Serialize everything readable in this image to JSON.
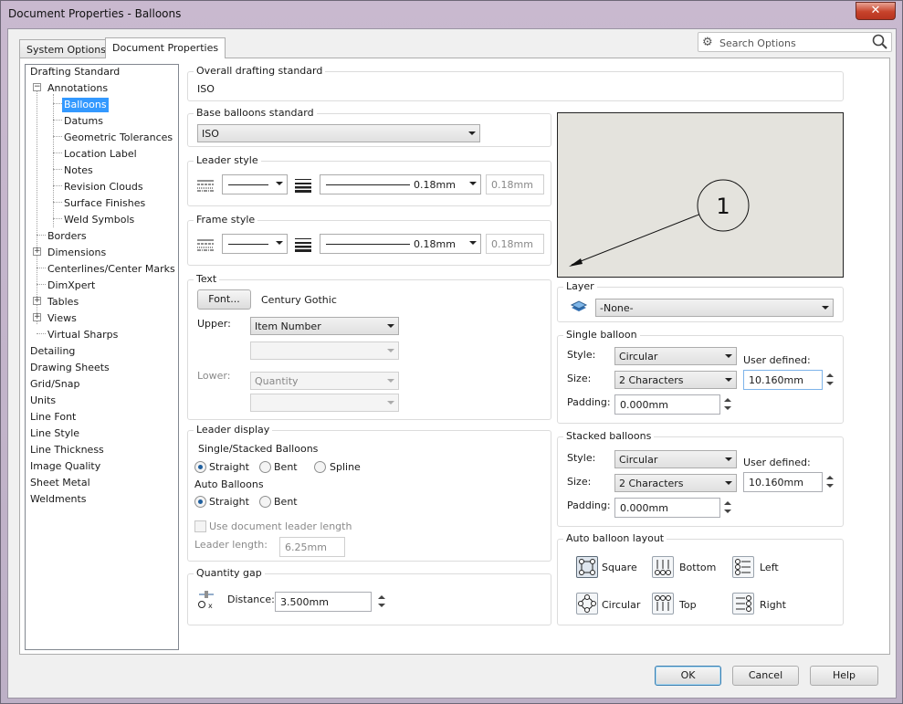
{
  "window": {
    "title": "Document Properties - Balloons",
    "close": "✕"
  },
  "tabs": [
    {
      "label": "System Options"
    },
    {
      "label": "Document Properties"
    }
  ],
  "search": {
    "placeholder": "Search Options"
  },
  "tree": {
    "items": [
      "Drafting Standard",
      "Annotations",
      "Balloons",
      "Datums",
      "Geometric Tolerances",
      "Location Label",
      "Notes",
      "Revision Clouds",
      "Surface Finishes",
      "Weld Symbols",
      "Borders",
      "Dimensions",
      "Centerlines/Center Marks",
      "DimXpert",
      "Tables",
      "Views",
      "Virtual Sharps",
      "Detailing",
      "Drawing Sheets",
      "Grid/Snap",
      "Units",
      "Line Font",
      "Line Style",
      "Line Thickness",
      "Image Quality",
      "Sheet Metal",
      "Weldments"
    ],
    "selected": "Balloons"
  },
  "overall": {
    "title": "Overall drafting standard",
    "value": "ISO"
  },
  "base": {
    "title": "Base balloons standard",
    "value": "ISO"
  },
  "leader_style": {
    "title": "Leader style",
    "thickness": "0.18mm",
    "custom": "0.18mm"
  },
  "frame_style": {
    "title": "Frame style",
    "thickness": "0.18mm",
    "custom": "0.18mm"
  },
  "text": {
    "title": "Text",
    "font_button": "Font...",
    "font_name": "Century Gothic",
    "upper_label": "Upper:",
    "upper_value": "Item Number",
    "lower_label": "Lower:",
    "lower_value": "Quantity"
  },
  "leader_display": {
    "title": "Leader display",
    "single_label": "Single/Stacked Balloons",
    "straight": "Straight",
    "bent": "Bent",
    "spline": "Spline",
    "auto_label": "Auto Balloons",
    "use_doc": "Use document leader length",
    "length_label": "Leader length:",
    "length_value": "6.25mm"
  },
  "quantity_gap": {
    "title": "Quantity gap",
    "distance_label": "Distance:",
    "distance_value": "3.500mm"
  },
  "preview": {
    "balloon_text": "1"
  },
  "layer": {
    "title": "Layer",
    "value": "-None-"
  },
  "single_balloon": {
    "title": "Single balloon",
    "style_label": "Style:",
    "style": "Circular",
    "size_label": "Size:",
    "size": "2 Characters",
    "user_defined_label": "User defined:",
    "user_defined": "10.160mm",
    "padding_label": "Padding:",
    "padding": "0.000mm"
  },
  "stacked_balloons": {
    "title": "Stacked balloons",
    "style_label": "Style:",
    "style": "Circular",
    "size_label": "Size:",
    "size": "2 Characters",
    "user_defined_label": "User defined:",
    "user_defined": "10.160mm",
    "padding_label": "Padding:",
    "padding": "0.000mm"
  },
  "auto_layout": {
    "title": "Auto balloon layout",
    "square": "Square",
    "bottom": "Bottom",
    "left": "Left",
    "circular": "Circular",
    "top": "Top",
    "right": "Right"
  },
  "footer": {
    "ok": "OK",
    "cancel": "Cancel",
    "help": "Help"
  }
}
